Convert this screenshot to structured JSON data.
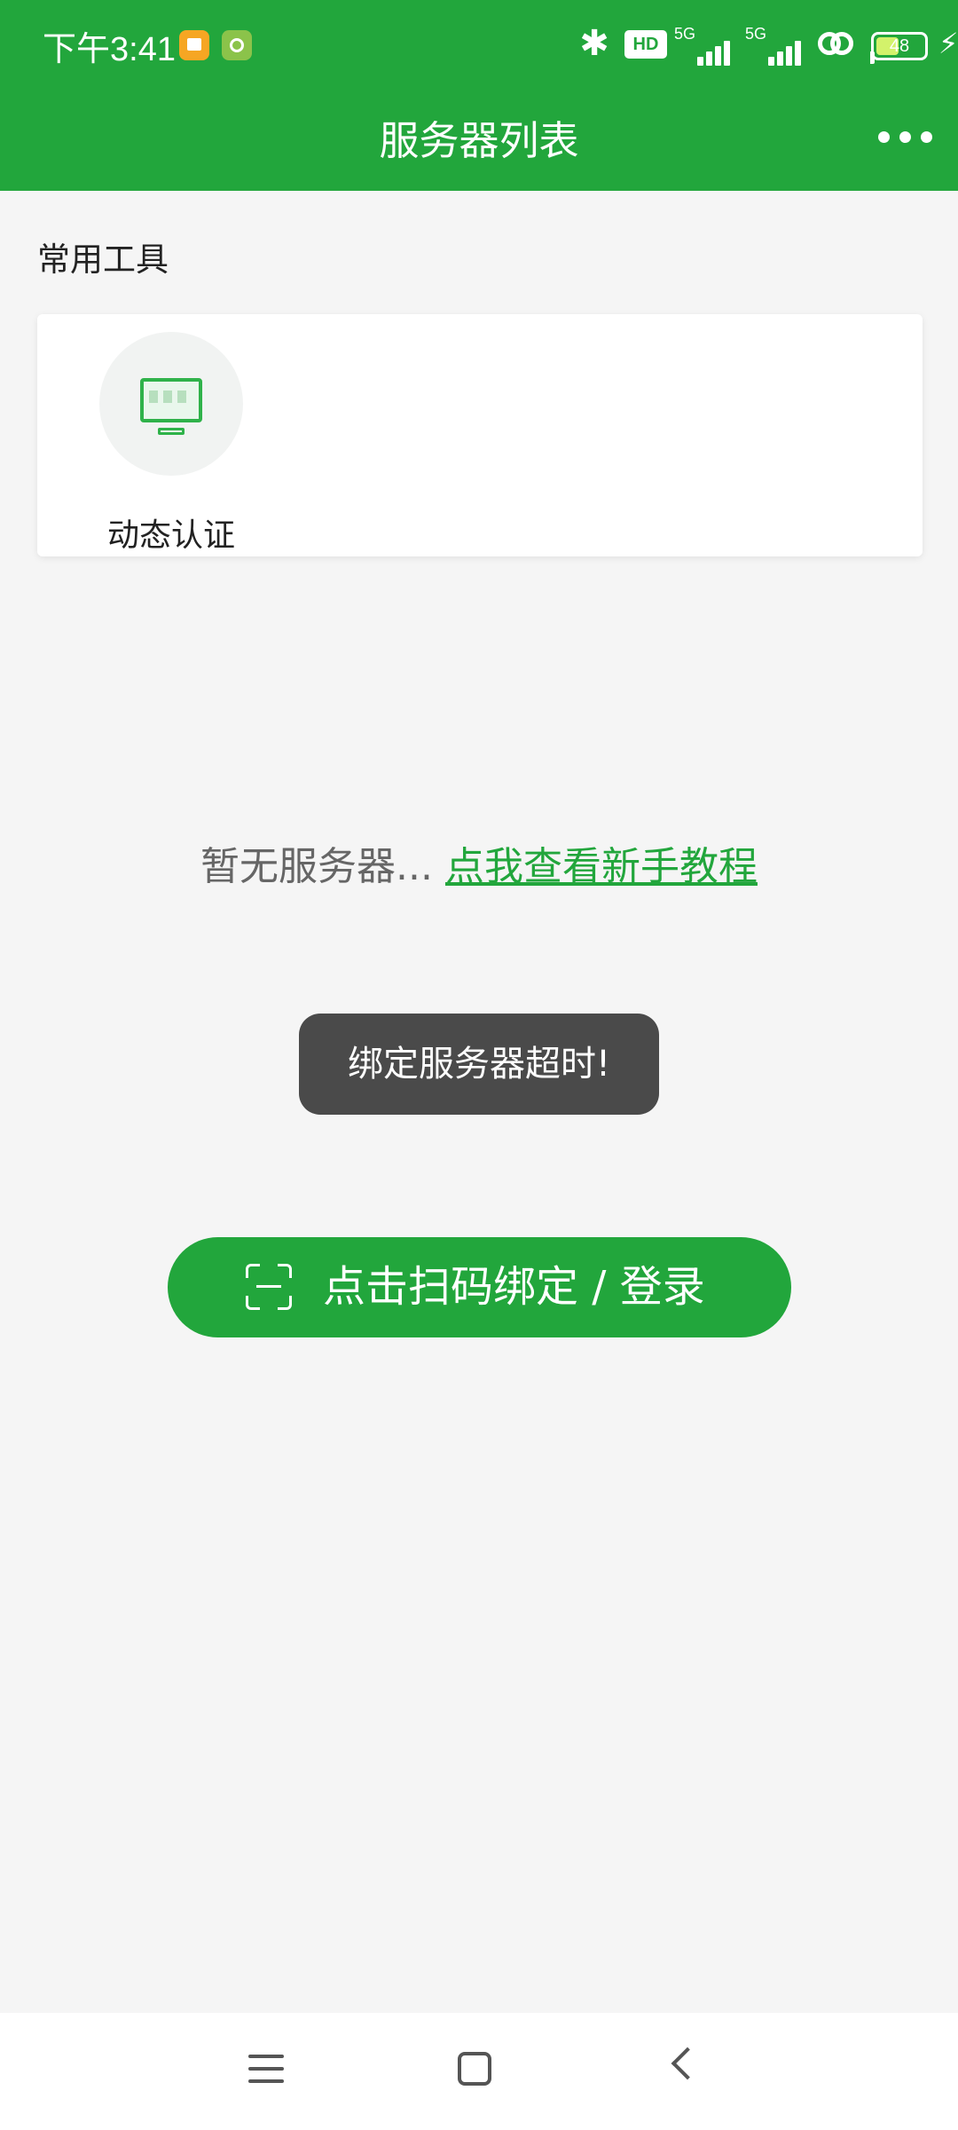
{
  "status_bar": {
    "time": "下午3:41",
    "bluetooth_icon": "bluetooth-icon",
    "hd_badge": "HD",
    "signal1_label": "5G",
    "signal2_label": "5G",
    "battery_level": "48",
    "battery_fraction": 0.48
  },
  "header": {
    "title": "服务器列表",
    "more_icon": "more-horizontal-icon"
  },
  "tools": {
    "section_label": "常用工具",
    "items": [
      {
        "label": "动态认证",
        "icon": "monitor-password-icon"
      }
    ]
  },
  "empty_state": {
    "text": "暂无服务器...",
    "link": "点我查看新手教程"
  },
  "toast": {
    "message": "绑定服务器超时!"
  },
  "scan_button": {
    "label": "点击扫码绑定 / 登录",
    "icon": "scan-icon"
  },
  "nav": {
    "menu_icon": "menu-icon",
    "home_icon": "home-icon",
    "back_icon": "back-icon"
  },
  "colors": {
    "accent": "#22a63c",
    "background": "#f5f5f5",
    "toast_bg": "#4a4a4a"
  }
}
